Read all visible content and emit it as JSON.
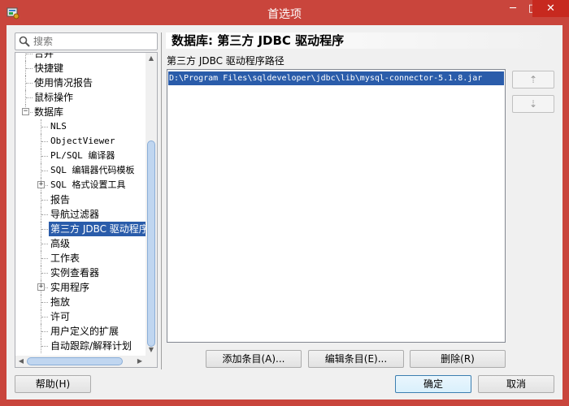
{
  "window": {
    "title": "首选项",
    "minimize": "─",
    "maximize": "□",
    "close": "✕"
  },
  "search": {
    "placeholder": "搜索"
  },
  "tree": {
    "items": [
      {
        "label": "合并",
        "level": 0
      },
      {
        "label": "快捷键",
        "level": 0
      },
      {
        "label": "使用情况报告",
        "level": 0
      },
      {
        "label": "鼠标操作",
        "level": 0
      },
      {
        "label": "数据库",
        "level": 0,
        "expanded": true
      },
      {
        "label": "NLS",
        "level": 1
      },
      {
        "label": "ObjectViewer",
        "level": 1
      },
      {
        "label": "PL/SQL 编译器",
        "level": 1
      },
      {
        "label": "SQL 编辑器代码模板",
        "level": 1
      },
      {
        "label": "SQL 格式设置工具",
        "level": 1,
        "collapsed": true
      },
      {
        "label": "报告",
        "level": 1
      },
      {
        "label": "导航过滤器",
        "level": 1
      },
      {
        "label": "第三方 JDBC 驱动程序",
        "level": 1,
        "selected": true
      },
      {
        "label": "高级",
        "level": 1
      },
      {
        "label": "工作表",
        "level": 1
      },
      {
        "label": "实例查看器",
        "level": 1
      },
      {
        "label": "实用程序",
        "level": 1,
        "collapsed": true
      },
      {
        "label": "拖放",
        "level": 1
      },
      {
        "label": "许可",
        "level": 1
      },
      {
        "label": "用户定义的扩展",
        "level": 1
      },
      {
        "label": "自动跟踪/解释计划",
        "level": 1
      }
    ]
  },
  "main": {
    "title": "数据库: 第三方 JDBC 驱动程序",
    "path_label": "第三方 JDBC 驱动程序路径",
    "paths": [
      "D:\\Program Files\\sqldeveloper\\jdbc\\lib\\mysql-connector-5.1.8.jar"
    ],
    "move_up": "⇡",
    "move_down": "⇣",
    "add_label": "添加条目(A)...",
    "edit_label": "编辑条目(E)...",
    "delete_label": "删除(R)"
  },
  "footer": {
    "help_label": "帮助(H)",
    "ok_label": "确定",
    "cancel_label": "取消"
  },
  "colors": {
    "titlebar": "#c9453c",
    "selection": "#2a5caa"
  }
}
